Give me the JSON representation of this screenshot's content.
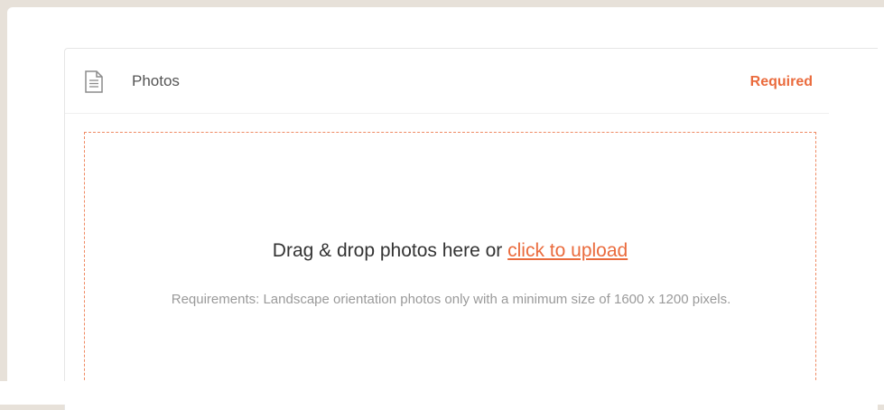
{
  "panel": {
    "title": "Photos",
    "icon": "document-icon",
    "required_label": "Required"
  },
  "dropzone": {
    "prompt": "Drag & drop photos here or",
    "upload_link": "click to upload",
    "requirements": "Requirements: Landscape orientation photos only with a minimum size of 1600 x 1200 pixels."
  },
  "colors": {
    "background": "#e7e1d9",
    "accent": "#ea6b3d",
    "border": "#e6e6e6"
  }
}
